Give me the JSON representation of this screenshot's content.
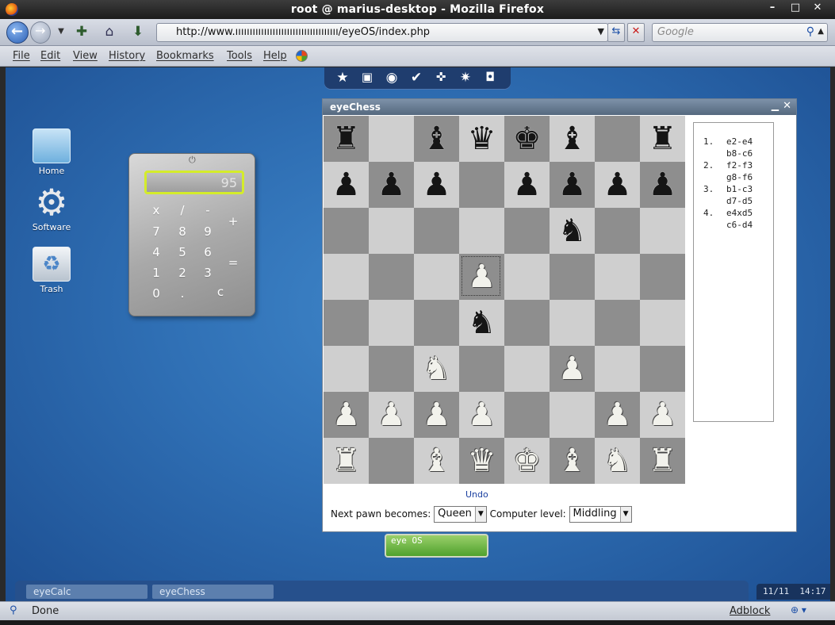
{
  "window": {
    "title": "root @ marius-desktop - Mozilla Firefox",
    "controls": [
      "–",
      "□",
      "✕"
    ]
  },
  "navbar": {
    "url": "http://www.ıııııııııııııııııııııııııııııııııııı/eyeOS/index.php",
    "search_placeholder": "Google"
  },
  "menu": [
    "File",
    "Edit",
    "View",
    "History",
    "Bookmarks",
    "Tools",
    "Help"
  ],
  "desktop_icons": [
    {
      "label": "Home",
      "icon": "folder-home-icon"
    },
    {
      "label": "Software",
      "icon": "gear-icon"
    },
    {
      "label": "Trash",
      "icon": "trash-icon"
    }
  ],
  "calculator": {
    "display": "95",
    "keys": {
      "mul": "x",
      "div": "/",
      "minus": "-",
      "plus": "+",
      "eq": "=",
      "k7": "7",
      "k8": "8",
      "k9": "9",
      "k4": "4",
      "k5": "5",
      "k6": "6",
      "k1": "1",
      "k2": "2",
      "k3": "3",
      "k0": "0",
      "dot": ".",
      "clear": "c"
    }
  },
  "chess": {
    "title": "eyeChess",
    "board": [
      [
        "r",
        "",
        "b",
        "q",
        "k",
        "b",
        "",
        "r"
      ],
      [
        "p",
        "p",
        "p",
        "",
        "p",
        "p",
        "p",
        "p"
      ],
      [
        "",
        "",
        "",
        "",
        "",
        "n",
        "",
        ""
      ],
      [
        "",
        "",
        "",
        "P",
        "",
        "",
        "",
        ""
      ],
      [
        "",
        "",
        "",
        "n",
        "",
        "",
        "",
        ""
      ],
      [
        "",
        "",
        "N",
        "",
        "",
        "P",
        "",
        ""
      ],
      [
        "P",
        "P",
        "P",
        "P",
        "",
        "",
        "P",
        "P"
      ],
      [
        "R",
        "",
        "B",
        "Q",
        "K",
        "B",
        "N",
        "R"
      ]
    ],
    "selected_square": "d5",
    "moves": [
      {
        "n": "1.",
        "white": "e2-e4",
        "black": "b8-c6"
      },
      {
        "n": "2.",
        "white": "f2-f3",
        "black": "g8-f6"
      },
      {
        "n": "3.",
        "white": "b1-c3",
        "black": "d7-d5"
      },
      {
        "n": "4.",
        "white": "e4xd5",
        "black": "c6-d4"
      }
    ],
    "undo_label": "Undo",
    "pawn_label": "Next pawn becomes:",
    "pawn_value": "Queen",
    "level_label": "Computer level:",
    "level_value": "Middling"
  },
  "eyeos_logo": "eye OS",
  "taskbar": {
    "tasks": [
      "eyeCalc",
      "eyeChess"
    ],
    "clock_date": "11/11",
    "clock_time": "14:17"
  },
  "statusbar": {
    "status": "Done",
    "adblock": "Adblock"
  },
  "colors": {
    "desktop": "#2f6fb4",
    "board_light": "#cfcfcf",
    "board_dark": "#8e8e8e",
    "calc_display_border": "#d4ec2a"
  }
}
